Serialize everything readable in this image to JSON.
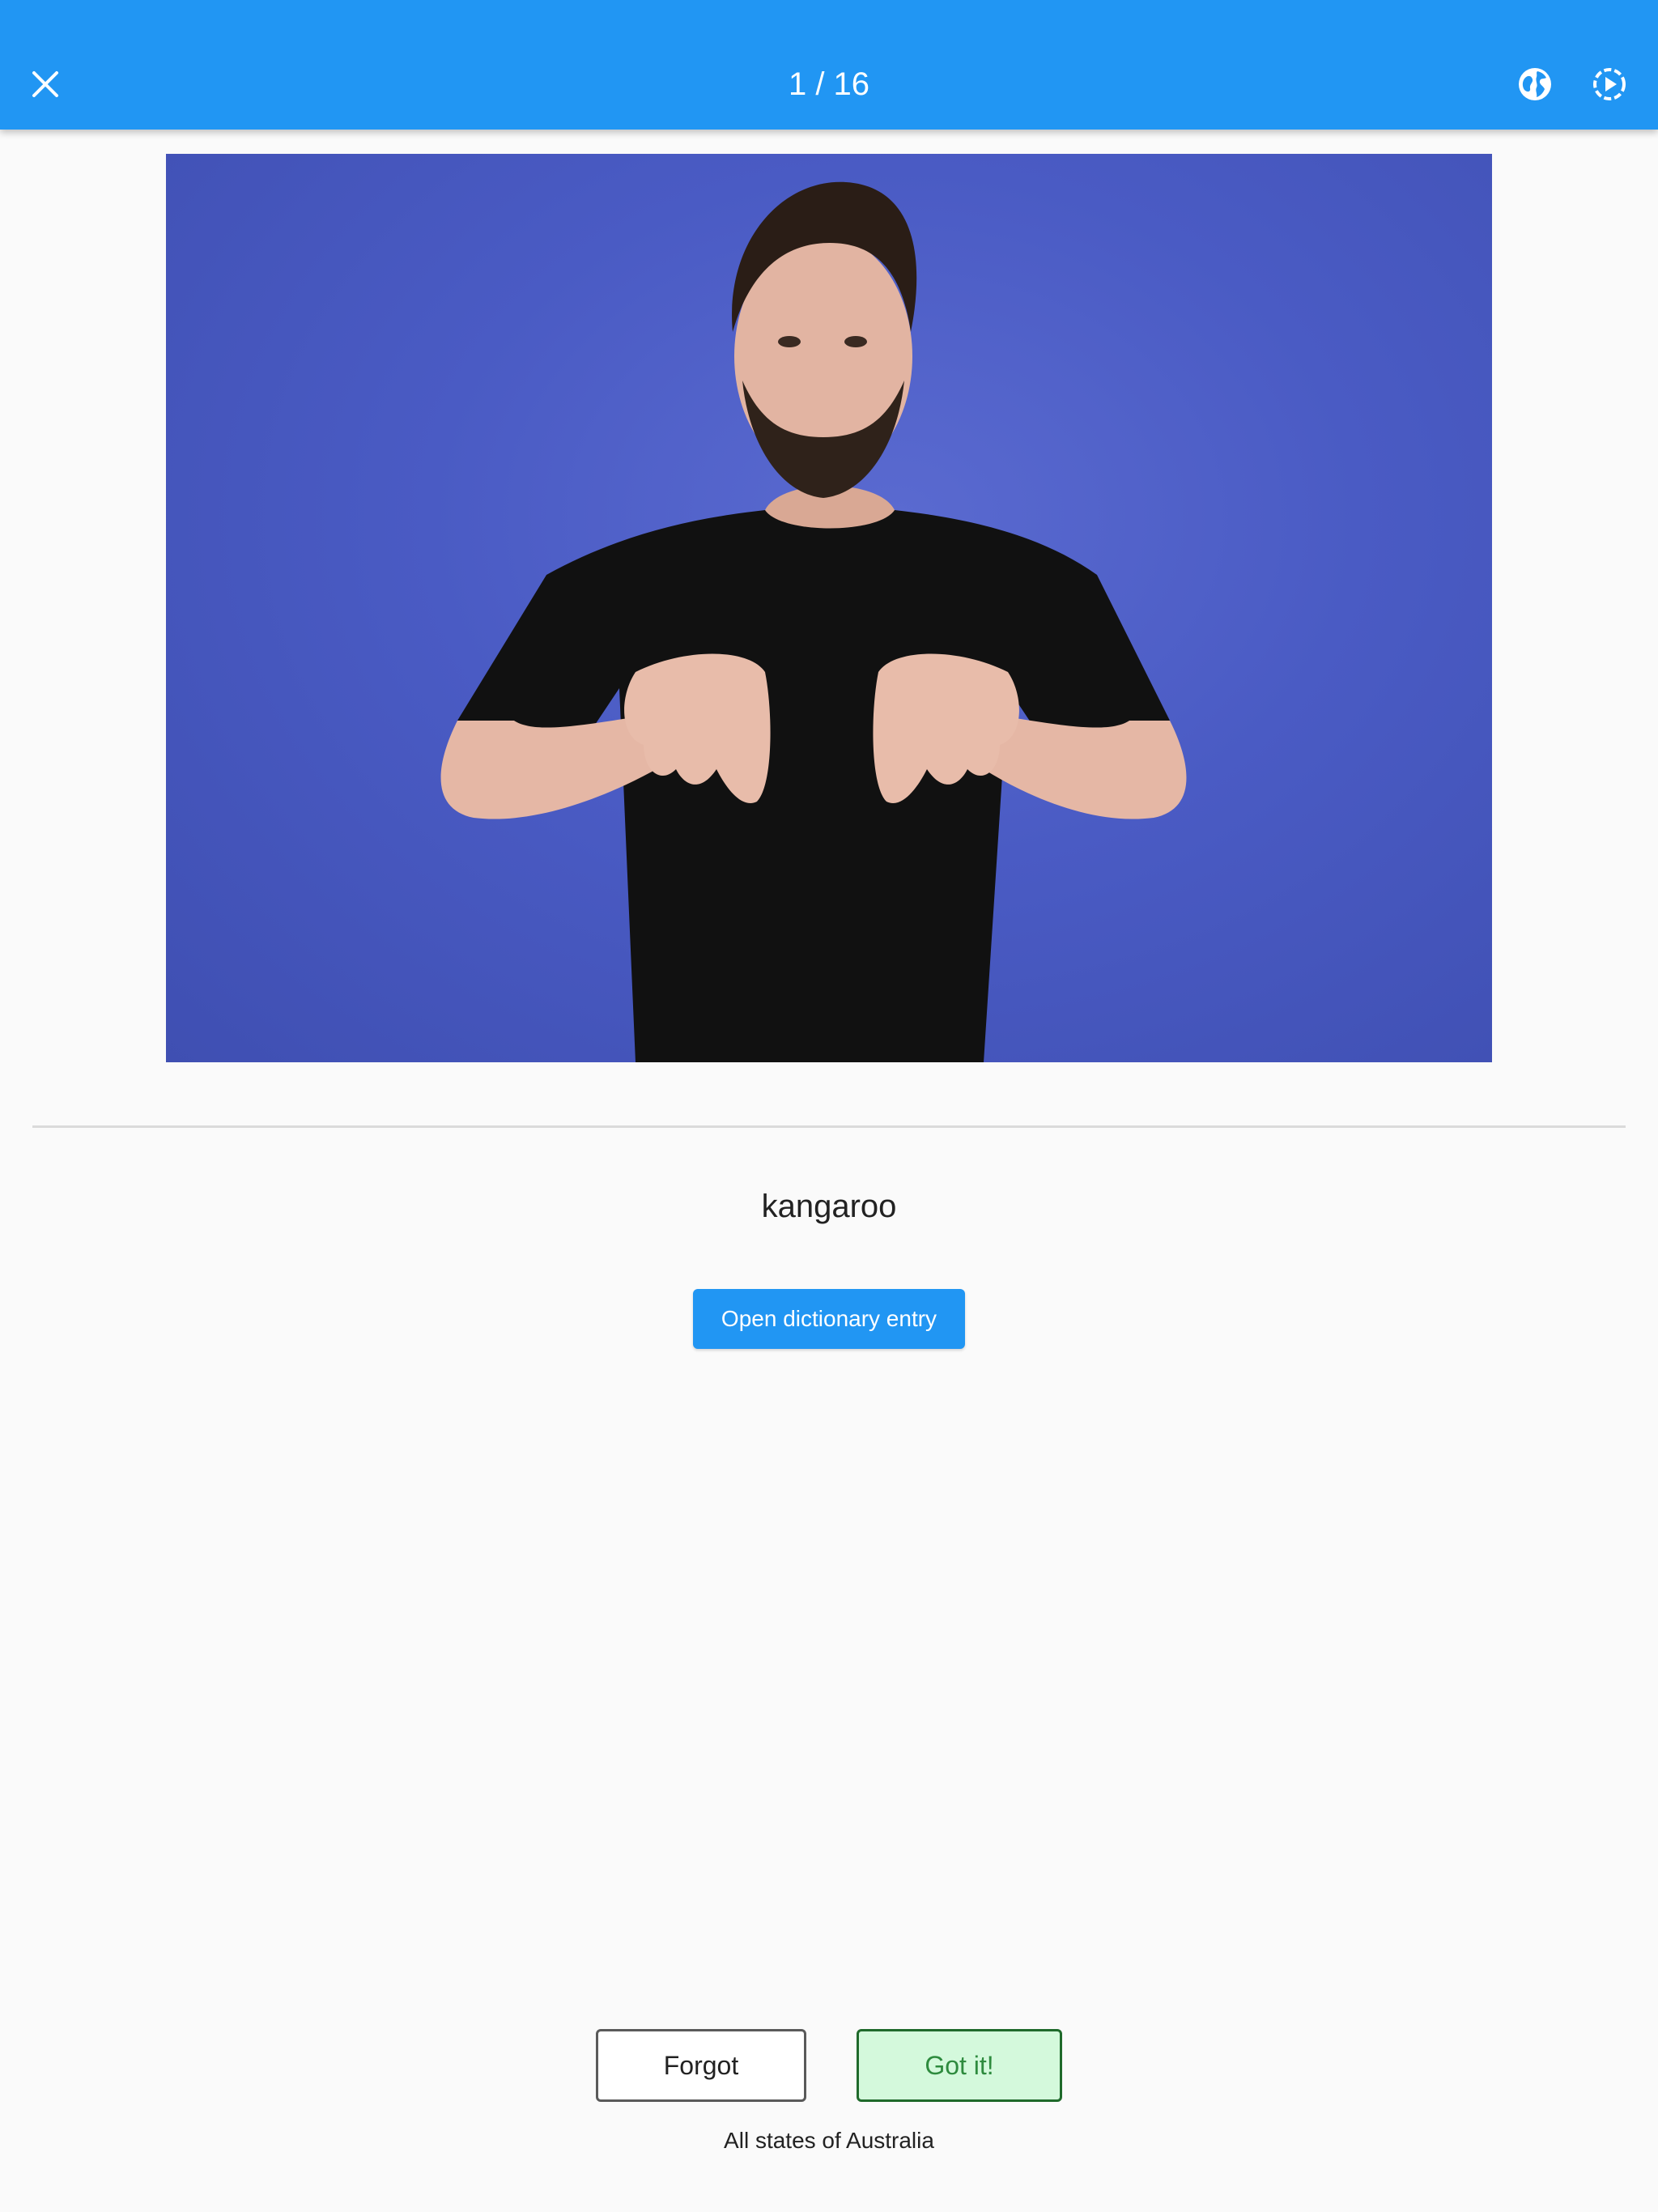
{
  "appbar": {
    "title": "1 / 16",
    "background_color": "#2196f3",
    "close_icon": "close-icon",
    "globe_icon": "globe-icon",
    "replay_icon": "replay-icon"
  },
  "video": {
    "background_color": "#4a5bc4",
    "subject": "person signing"
  },
  "card": {
    "word": "kangaroo",
    "dictionary_button_label": "Open dictionary entry"
  },
  "actions": {
    "forgot_label": "Forgot",
    "got_it_label": "Got it!",
    "got_it_color": "#d4f9dc"
  },
  "footer": {
    "region": "All states of Australia"
  }
}
